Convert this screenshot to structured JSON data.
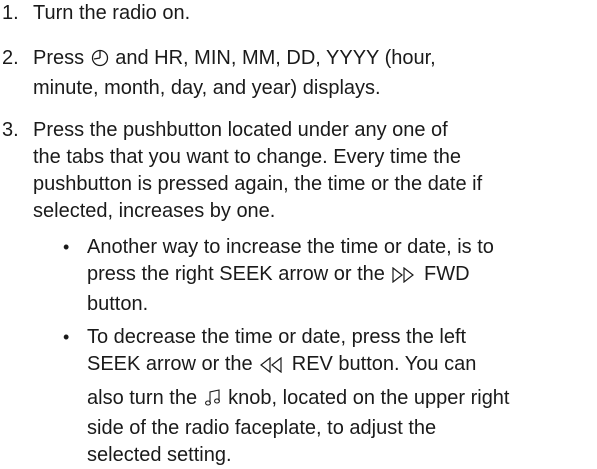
{
  "steps": [
    {
      "number": "1.",
      "lines": [
        "Turn the radio on."
      ]
    },
    {
      "number": "2.",
      "line1_before_icon": "Press ",
      "line1_after_icon": " and HR, MIN, MM, DD, YYYY (hour,",
      "line2": "minute, month, day, and year) displays.",
      "icon": "clock-icon"
    },
    {
      "number": "3.",
      "lines": [
        "Press the pushbutton located under any one of",
        "the tabs that you want to change. Every time the",
        "pushbutton is pressed again, the time or the date if",
        "selected, increases by one."
      ]
    }
  ],
  "bullets": [
    {
      "symbol": "•",
      "line1": "Another way to increase the time or date, is to",
      "line2_before_icon": "press the right SEEK arrow or the ",
      "line2_after_icon": " FWD",
      "line3": "button.",
      "icon": "fast-forward-icon"
    },
    {
      "symbol": "•",
      "line1": "To decrease the time or date, press the left",
      "line2_before_icon": "SEEK arrow or the ",
      "line2_after_icon": " REV button. You can",
      "line3_before_icon": "also turn the ",
      "line3_after_icon": " knob, located on the upper right",
      "line4": "side of the radio faceplate, to adjust the",
      "line5": "selected setting.",
      "icon_rev": "rewind-icon",
      "icon_knob": "music-note-knob-icon"
    }
  ]
}
